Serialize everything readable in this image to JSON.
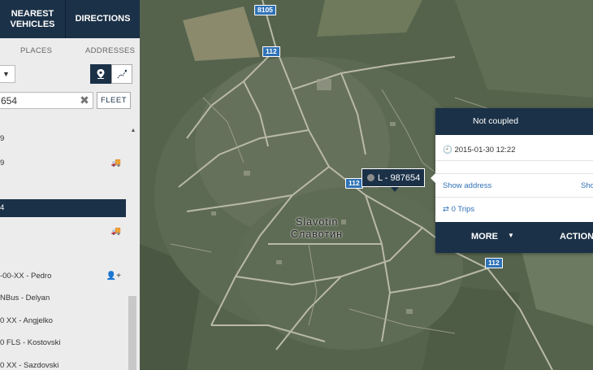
{
  "tabs": {
    "nearest": "Nearest vehicles",
    "directions": "DIRECTIONS"
  },
  "subtabs": {
    "places": "PLACES",
    "addresses": "ADDRESSES"
  },
  "search": {
    "value": "654",
    "fleet_label": "FLEET"
  },
  "list": [
    {
      "text": "9",
      "icon": ""
    },
    {
      "text": "9",
      "icon": "truck"
    },
    {
      "text": "4",
      "icon": "",
      "selected": true
    },
    {
      "text": "",
      "icon": "truck"
    },
    {
      "text": "-00-XX - Pedro",
      "icon": "user-plus"
    },
    {
      "text": "NBus - Delyan",
      "icon": ""
    },
    {
      "text": "0 XX - Angjelko",
      "icon": ""
    },
    {
      "text": "0 FLS - Kostovski",
      "icon": ""
    },
    {
      "text": "0 XX - Sazdovski",
      "icon": ""
    }
  ],
  "map": {
    "roads": [
      "8105",
      "112",
      "112",
      "112"
    ],
    "town_latin": "Slavotin",
    "town_cyrillic": "Славотин"
  },
  "vehicle_label": "L - 987654",
  "popup": {
    "header": "Not coupled",
    "timestamp": "2015-01-30 12:22",
    "show_address": "Show address",
    "show_right": "Sho",
    "trips": "0 Trips",
    "more": "MORE",
    "actions": "ACTION"
  },
  "colors": {
    "navy": "#1b3147",
    "road_badge": "#2f72b6",
    "link": "#2f72b6"
  }
}
